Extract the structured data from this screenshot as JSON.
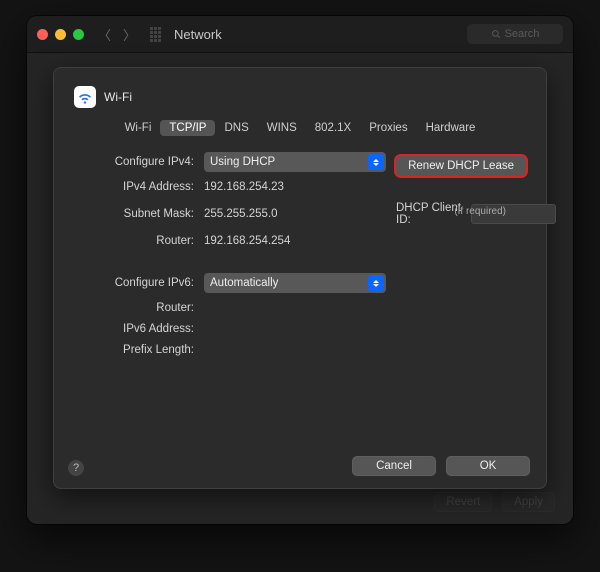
{
  "titlebar": {
    "title": "Network",
    "search_placeholder": "Search"
  },
  "background_buttons": {
    "revert": "Revert",
    "apply": "Apply"
  },
  "sheet": {
    "connection_name": "Wi-Fi",
    "tabs": [
      {
        "label": "Wi-Fi",
        "active": false
      },
      {
        "label": "TCP/IP",
        "active": true
      },
      {
        "label": "DNS",
        "active": false
      },
      {
        "label": "WINS",
        "active": false
      },
      {
        "label": "802.1X",
        "active": false
      },
      {
        "label": "Proxies",
        "active": false
      },
      {
        "label": "Hardware",
        "active": false
      }
    ],
    "ipv4": {
      "configure_label": "Configure IPv4:",
      "configure_value": "Using DHCP",
      "address_label": "IPv4 Address:",
      "address_value": "192.168.254.23",
      "subnet_label": "Subnet Mask:",
      "subnet_value": "255.255.255.0",
      "router_label": "Router:",
      "router_value": "192.168.254.254",
      "dhcp_client_id_label": "DHCP Client ID:",
      "dhcp_client_id_value": "",
      "if_required": "(If required)"
    },
    "ipv6": {
      "configure_label": "Configure IPv6:",
      "configure_value": "Automatically",
      "router_label": "Router:",
      "router_value": "",
      "address_label": "IPv6 Address:",
      "address_value": "",
      "prefix_label": "Prefix Length:",
      "prefix_value": ""
    },
    "renew_button": "Renew DHCP Lease",
    "buttons": {
      "cancel": "Cancel",
      "ok": "OK"
    }
  }
}
